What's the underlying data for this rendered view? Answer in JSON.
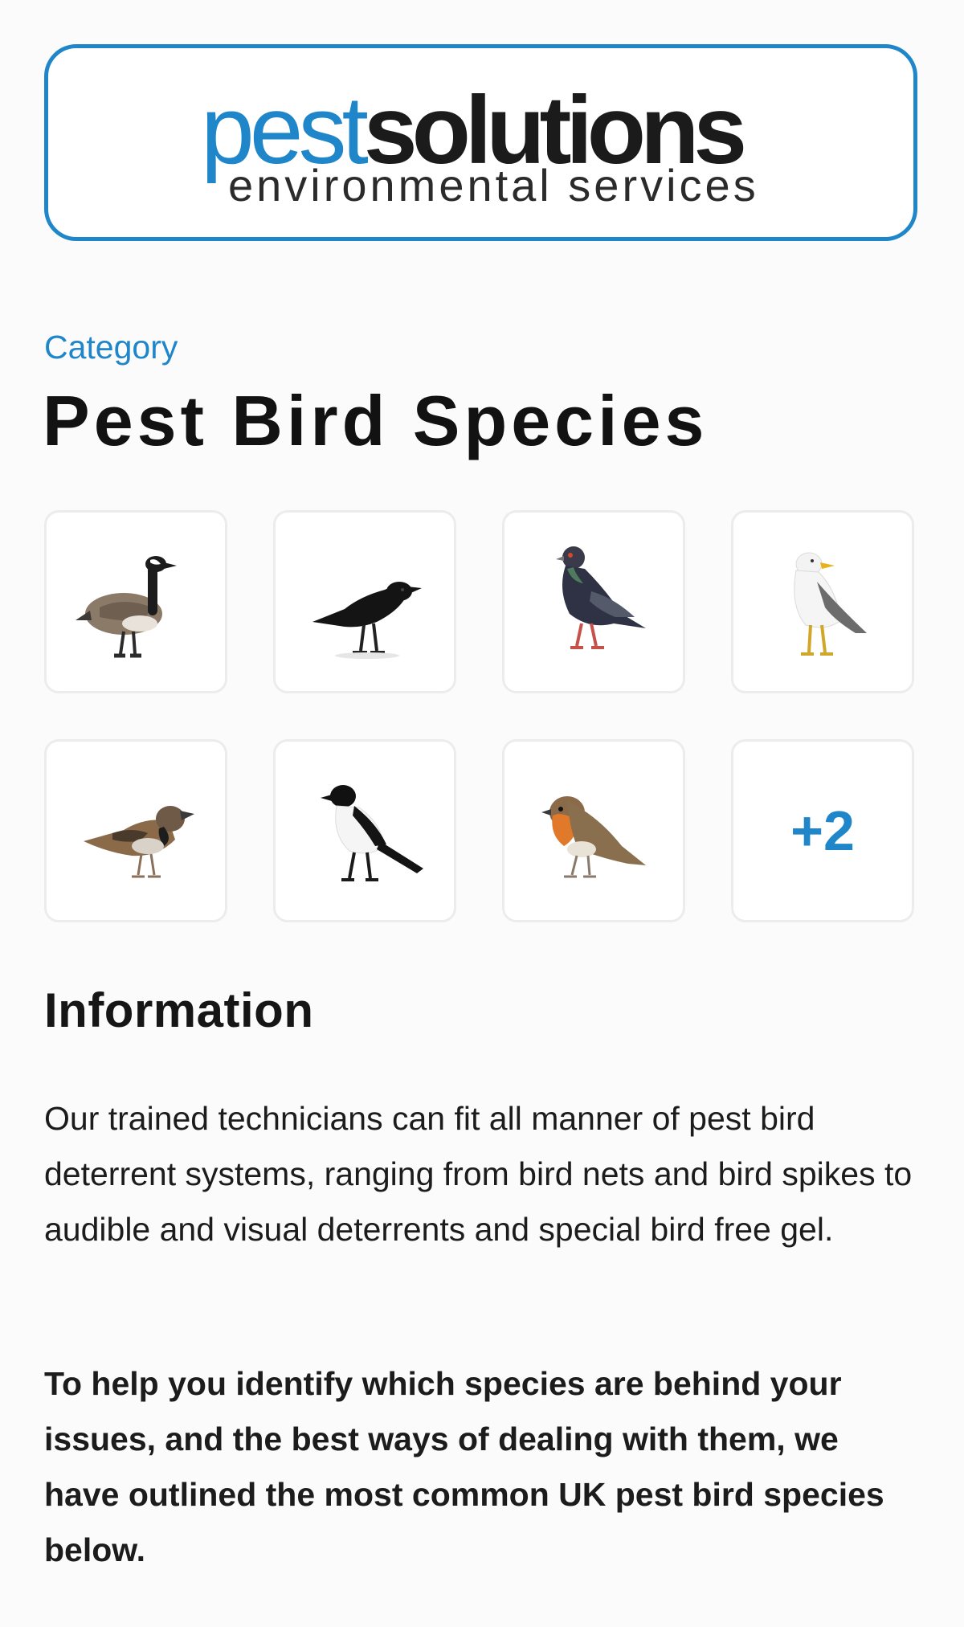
{
  "logo": {
    "word_pest": "pest",
    "word_solutions": "solutions",
    "tagline": "environmental services",
    "brand_color": "#1f86c9"
  },
  "header": {
    "category_label": "Category",
    "title": "Pest Bird Species"
  },
  "species_grid": {
    "tiles": [
      {
        "icon": "goose-icon"
      },
      {
        "icon": "crow-icon"
      },
      {
        "icon": "pigeon-icon"
      },
      {
        "icon": "gull-icon"
      },
      {
        "icon": "sparrow-icon"
      },
      {
        "icon": "magpie-icon"
      },
      {
        "icon": "robin-icon"
      }
    ],
    "more_label": "+2"
  },
  "information": {
    "heading": "Information",
    "body": "Our trained technicians can fit all manner of pest bird deterrent systems, ranging from bird nets and bird spikes to audible and visual deterrents and special bird free gel.",
    "highlight": "To help you identify which species are behind your issues, and the best ways of dealing with them, we have outlined the most common UK pest bird species below."
  }
}
